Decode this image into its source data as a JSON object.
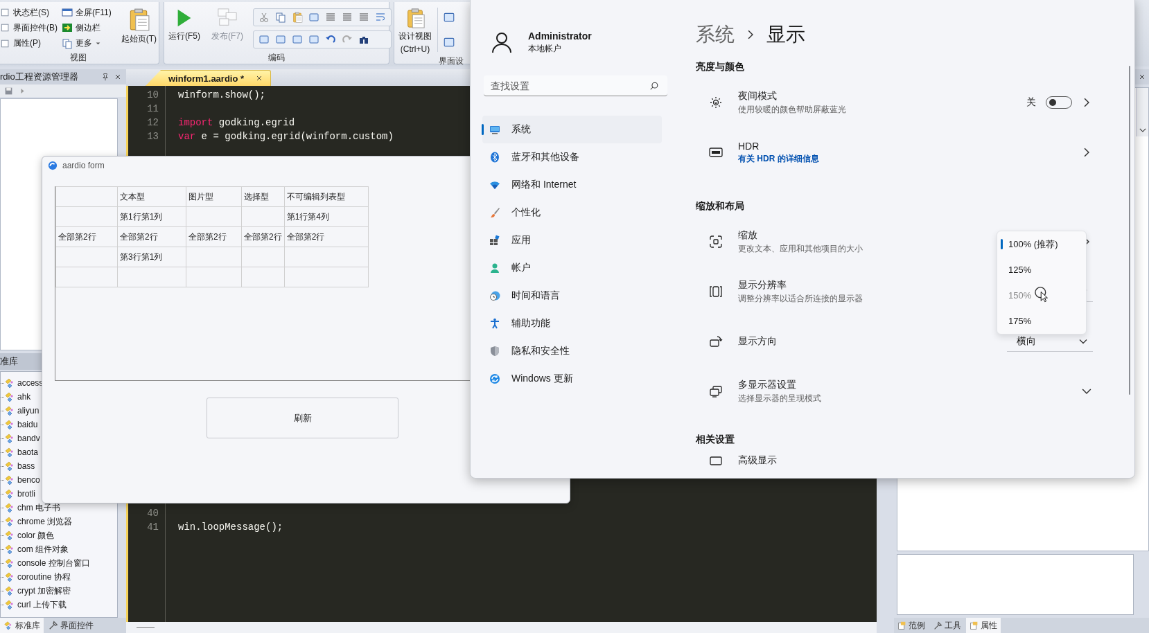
{
  "ide": {
    "ribbon": {
      "view": {
        "label": "视图",
        "checks": [
          {
            "label": "状态栏(S)",
            "checked": false
          },
          {
            "label": "界面控件(B)",
            "checked": false
          },
          {
            "label": "属性(P)",
            "checked": false
          }
        ],
        "commands": [
          {
            "label": "全屏(F11)",
            "kind": "plain"
          },
          {
            "label": "侧边栏",
            "kind": "plain"
          },
          {
            "label": "更多",
            "kind": "menu"
          }
        ],
        "start_page": "起始页(T)"
      },
      "code": {
        "label": "编码",
        "run": {
          "label": "运行(F5)",
          "disabled": false
        },
        "publish": {
          "label": "发布(F7)",
          "disabled": true
        }
      },
      "design": {
        "label": "界面设",
        "design_view": [
          "设计视图",
          "(Ctrl+U)"
        ]
      }
    },
    "project_panel": {
      "title": "rdio工程资源管理器"
    },
    "library_panel": {
      "title": "准库",
      "items": [
        "access",
        "ahk",
        "aliyun",
        "baidu",
        "bandv",
        "baota",
        "bass",
        "benco",
        "brotli",
        "chm 电子书",
        "chrome 浏览器",
        "color 颜色",
        "com 组件对象",
        "console 控制台窗口",
        "coroutine 协程",
        "crypt 加密解密",
        "curl 上传下载"
      ],
      "tabs": [
        {
          "label": "标准库",
          "selected": true
        },
        {
          "label": "界面控件",
          "selected": false
        }
      ]
    },
    "editor": {
      "tab": "winform1.aardio *",
      "lines_top": [
        {
          "number": "10",
          "code": [
            {
              "text": "winform.show();",
              "kind": "plain"
            }
          ]
        },
        {
          "number": "11"
        },
        {
          "number": "12",
          "code": [
            {
              "text": "import",
              "kind": "keyword"
            },
            {
              "text": " godking.egrid",
              "kind": "plain"
            }
          ]
        },
        {
          "number": "13",
          "code": [
            {
              "text": "var",
              "kind": "keyword"
            },
            {
              "text": " e = godking.egrid(winform.custom)",
              "kind": "plain"
            }
          ]
        }
      ],
      "lines_bottom": [
        {
          "number": "40"
        },
        {
          "number": "41",
          "code": [
            {
              "text": "win.loopMessage();",
              "kind": "plain"
            }
          ]
        }
      ]
    },
    "right_panel": {
      "tabs": [
        {
          "label": "范例",
          "selected": false
        },
        {
          "label": "工具",
          "selected": false
        },
        {
          "label": "属性",
          "selected": true
        }
      ]
    }
  },
  "form_window": {
    "title": "aardio form",
    "grid": {
      "columns": [
        "",
        "文本型",
        "图片型",
        "选择型",
        "不可编辑列表型"
      ],
      "rows": [
        [
          "",
          "第1行第1列",
          "",
          "",
          "第1行第4列"
        ],
        [
          "全部第2行",
          "全部第2行",
          "全部第2行",
          "全部第2行",
          "全部第2行"
        ],
        [
          "",
          "第3行第1列",
          "",
          "",
          ""
        ],
        [
          "",
          "",
          "",
          "",
          ""
        ]
      ]
    },
    "button": "刷新"
  },
  "settings_window": {
    "user": {
      "name": "Administrator",
      "account": "本地帐户"
    },
    "search": {
      "placeholder": "查找设置"
    },
    "nav": [
      {
        "label": "系统",
        "selected": true
      },
      {
        "label": "蓝牙和其他设备",
        "selected": false
      },
      {
        "label": "网络和 Internet",
        "selected": false
      },
      {
        "label": "个性化",
        "selected": false
      },
      {
        "label": "应用",
        "selected": false
      },
      {
        "label": "帐户",
        "selected": false
      },
      {
        "label": "时间和语言",
        "selected": false
      },
      {
        "label": "辅助功能",
        "selected": false
      },
      {
        "label": "隐私和安全性",
        "selected": false
      },
      {
        "label": "Windows 更新",
        "selected": false
      }
    ],
    "breadcrumb": [
      "系统",
      "显示"
    ],
    "sections": [
      {
        "title": "亮度与颜色",
        "rows": [
          {
            "kind": "toggle",
            "title": "夜间模式",
            "subtitle": "使用较暖的颜色帮助屏蔽蓝光",
            "state_label": "关",
            "on": false
          },
          {
            "kind": "link",
            "title": "HDR",
            "link": "有关 HDR 的详细信息"
          }
        ]
      },
      {
        "title": "缩放和布局",
        "rows": [
          {
            "kind": "next",
            "title": "缩放",
            "subtitle": "更改文本、应用和其他项目的大小"
          },
          {
            "kind": "dropdown",
            "title": "显示分辨率",
            "subtitle": "调整分辨率以适合所连接的显示器"
          },
          {
            "kind": "dropdown",
            "title": "显示方向",
            "value": "横向"
          },
          {
            "kind": "expand",
            "title": "多显示器设置",
            "subtitle": "选择显示器的呈现模式"
          }
        ]
      },
      {
        "title": "相关设置",
        "rows": [
          {
            "kind": "cut",
            "title": "高级显示"
          }
        ]
      }
    ],
    "scale_menu": [
      {
        "label": "100% (推荐)",
        "selected": true,
        "hovered": false
      },
      {
        "label": "125%",
        "selected": false,
        "hovered": false
      },
      {
        "label": "150%",
        "selected": false,
        "hovered": true
      },
      {
        "label": "175%",
        "selected": false,
        "hovered": false
      }
    ]
  }
}
